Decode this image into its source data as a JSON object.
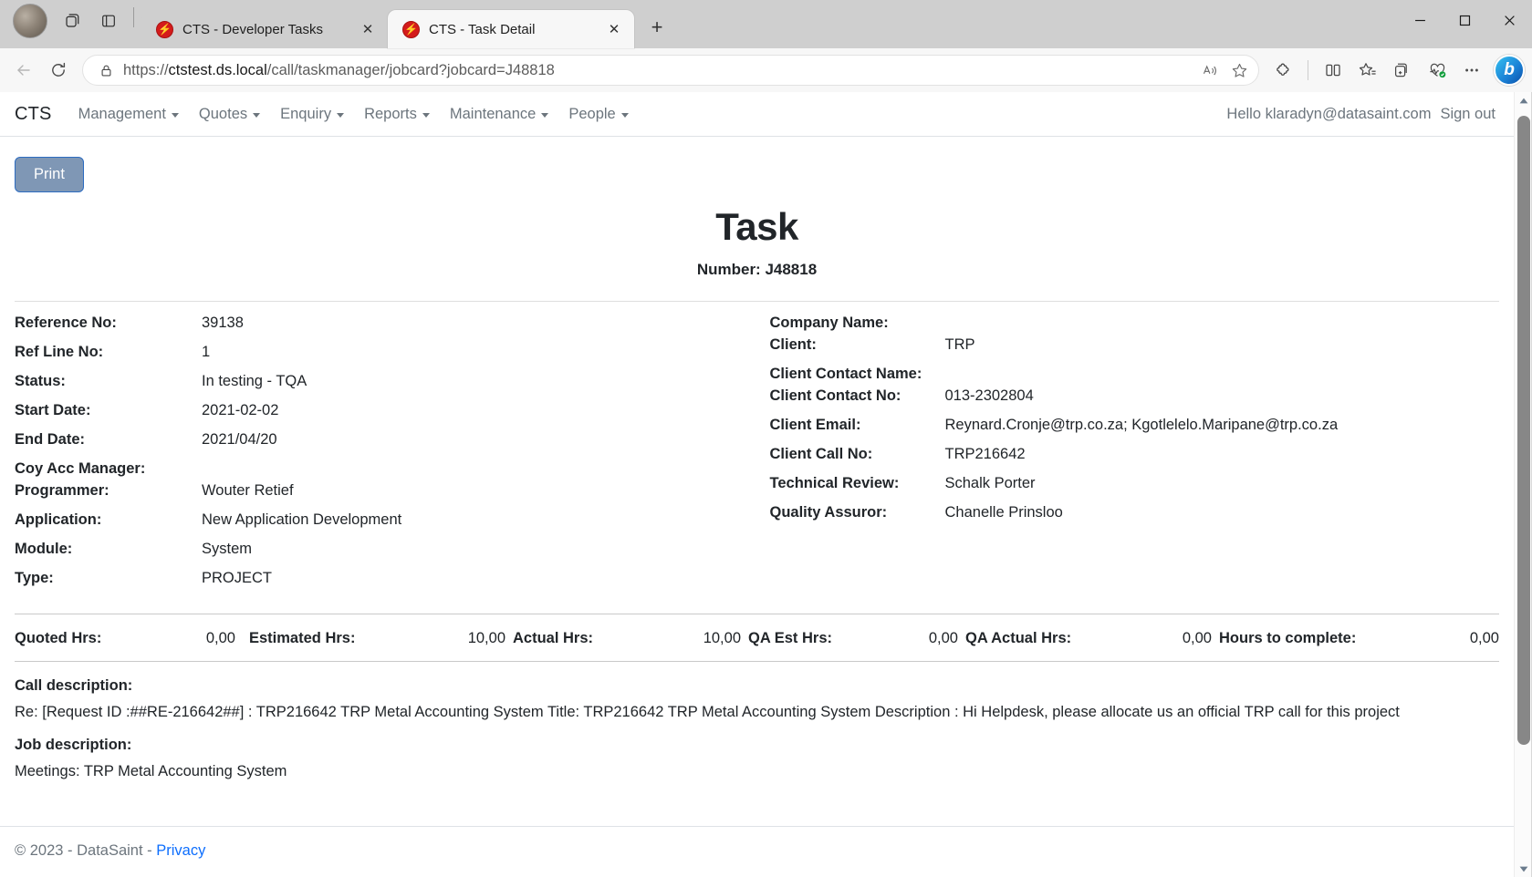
{
  "browser": {
    "tabs": [
      {
        "title": "CTS - Developer Tasks",
        "active": false,
        "favicon": "cts-favicon",
        "close_label": "✕"
      },
      {
        "title": "CTS - Task Detail",
        "active": true,
        "favicon": "cts-favicon",
        "close_label": "✕"
      }
    ],
    "new_tab_label": "+",
    "window_controls": {
      "minimize": "—",
      "maximize": "☐",
      "close": "✕"
    },
    "toolbar": {
      "back_label": "←",
      "refresh_label": "↻",
      "url_full": "https://ctstest.ds.local/call/taskmanager/jobcard?jobcard=J48818",
      "url_scheme": "https://",
      "url_host": "ctstest.ds.local",
      "url_path": "/call/taskmanager/jobcard?jobcard=J48818",
      "read_aloud_label": "A",
      "favorite_label": "☆",
      "extensions_label": "extensions",
      "split_screen_label": "split-screen",
      "collections_label": "collections",
      "add_favorite_label": "add-to-favorites",
      "browser_essentials_label": "browser-essentials",
      "settings_more_label": "…",
      "copilot_label": "b"
    }
  },
  "app": {
    "brand": "CTS",
    "nav_items": [
      {
        "label": "Management",
        "has_caret": true
      },
      {
        "label": "Quotes",
        "has_caret": true
      },
      {
        "label": "Enquiry",
        "has_caret": true
      },
      {
        "label": "Reports",
        "has_caret": true
      },
      {
        "label": "Maintenance",
        "has_caret": true
      },
      {
        "label": "People",
        "has_caret": true
      }
    ],
    "greeting": "Hello klaradyn@datasaint.com",
    "sign_out": "Sign out"
  },
  "page": {
    "print_label": "Print",
    "title": "Task",
    "subtitle": "Number: J48818",
    "left_fields": [
      {
        "label": "Reference No:",
        "value": "39138"
      },
      {
        "label": "Ref Line No:",
        "value": "1"
      },
      {
        "label": "Status:",
        "value": "In testing - TQA"
      },
      {
        "label": "Start Date:",
        "value": "2021-02-02"
      },
      {
        "label": "End Date:",
        "value": "2021/04/20"
      },
      {
        "label": "Coy Acc Manager:",
        "value": ""
      },
      {
        "label": "Programmer:",
        "value": "Wouter Retief"
      },
      {
        "label": "Application:",
        "value": "New Application Development"
      },
      {
        "label": "Module:",
        "value": "System"
      },
      {
        "label": "Type:",
        "value": "PROJECT"
      }
    ],
    "right_fields": [
      {
        "label": "Company Name:",
        "value": ""
      },
      {
        "label": "Client:",
        "value": "TRP"
      },
      {
        "label": "Client Contact Name:",
        "value": ""
      },
      {
        "label": "Client Contact No:",
        "value": "013-2302804"
      },
      {
        "label": "Client Email:",
        "value": "Reynard.Cronje@trp.co.za; Kgotlelelo.Maripane@trp.co.za"
      },
      {
        "label": "Client Call No:",
        "value": "TRP216642"
      },
      {
        "label": "Technical Review:",
        "value": "Schalk Porter"
      },
      {
        "label": "Quality Assuror:",
        "value": "Chanelle Prinsloo"
      }
    ],
    "hours": [
      {
        "label": "Quoted Hrs:",
        "value": "0,00"
      },
      {
        "label": "Estimated Hrs:",
        "value": "10,00"
      },
      {
        "label": "Actual Hrs:",
        "value": "10,00"
      },
      {
        "label": "QA Est Hrs:",
        "value": "0,00"
      },
      {
        "label": "QA Actual Hrs:",
        "value": "0,00"
      },
      {
        "label": "Hours to complete:",
        "value": "0,00"
      }
    ],
    "call_description_label": "Call description:",
    "call_description": "Re: [Request ID :##RE-216642##] : TRP216642 TRP Metal Accounting System Title: TRP216642 TRP Metal Accounting System Description : Hi Helpdesk, please allocate us an official TRP call for this project",
    "job_description_label": "Job description:",
    "job_description": "Meetings: TRP Metal Accounting System",
    "footer_text": "© 2023 - DataSaint - ",
    "footer_link": "Privacy"
  },
  "colors": {
    "accent": "#0d6efd",
    "print_button_bg": "#7f97b5",
    "print_button_border": "#2d6cc0",
    "muted_text": "#6c757d",
    "favicon_red": "#d41b1b"
  }
}
